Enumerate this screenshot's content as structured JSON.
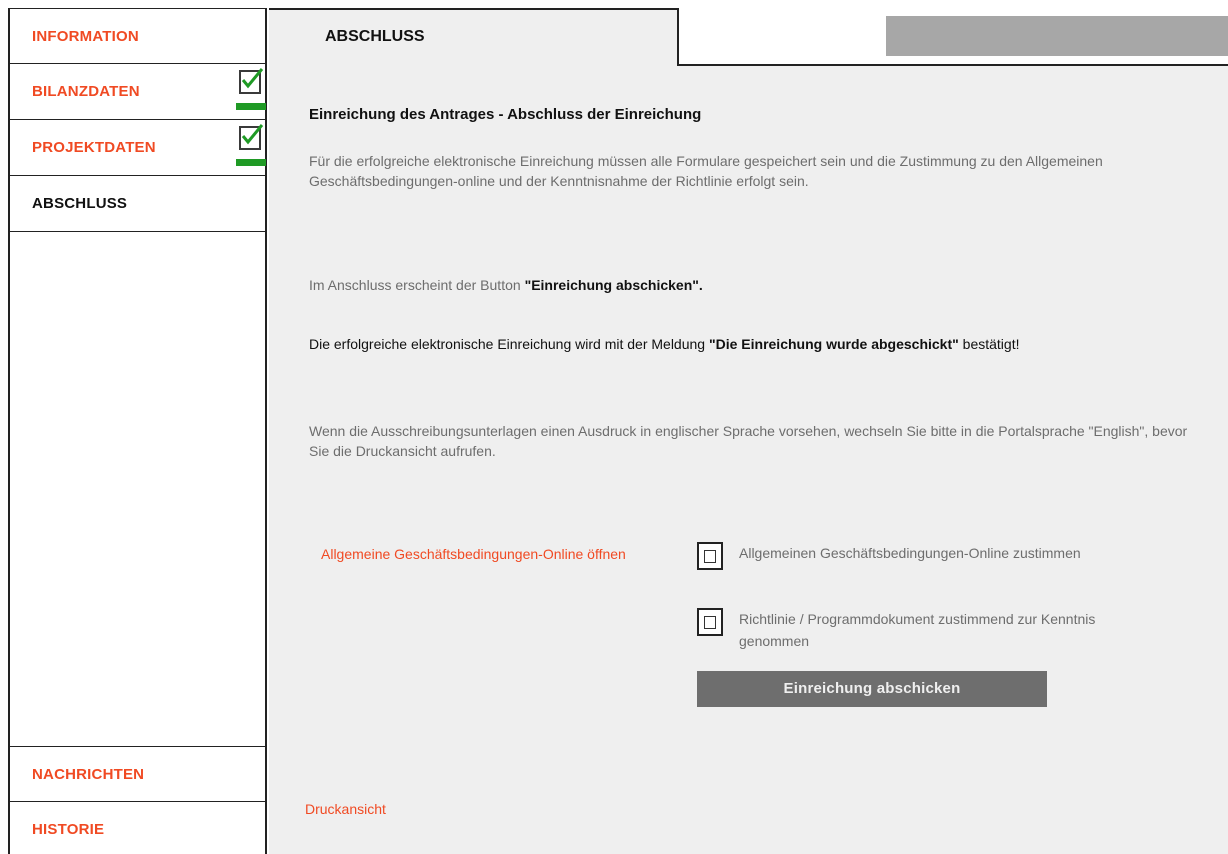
{
  "sidebar": {
    "items": [
      {
        "label": "INFORMATION",
        "checked": false
      },
      {
        "label": "BILANZDATEN",
        "checked": true
      },
      {
        "label": "PROJEKTDATEN",
        "checked": true
      },
      {
        "label": "ABSCHLUSS",
        "active": true
      }
    ],
    "bottom_items": [
      {
        "label": "NACHRICHTEN"
      },
      {
        "label": "HISTORIE"
      }
    ],
    "check_icon": "checkmark-icon",
    "colors": {
      "link": "#f04a23",
      "check": "#1f9a25"
    }
  },
  "tab": {
    "label": "ABSCHLUSS"
  },
  "content": {
    "heading": "Einreichung des Antrages - Abschluss der Einreichung",
    "para1": " Für die erfolgreiche elektronische Einreichung müssen alle Formulare gespeichert sein und die Zustimmung zu den Allgemeinen Geschäftsbedingungen-online und der Kenntnisnahme der Richtlinie erfolgt sein.",
    "para2_prefix": "Im Anschluss erscheint der Button ",
    "para2_bold": "\"Einreichung abschicken\".",
    "para3_prefix": "Die erfolgreiche elektronische Einreichung wird mit der Meldung ",
    "para3_bold": "\"Die Einreichung wurde abgeschickt\"",
    "para3_suffix": " bestätigt!",
    "para4": "Wenn die Ausschreibungsunterlagen einen Ausdruck in englischer Sprache vorsehen, wechseln Sie bitte in die Portalsprache \"English\", bevor Sie die Druckansicht aufrufen.",
    "agb_link": "Allgemeine Geschäftsbedingungen-Online öffnen",
    "checkbox1_label": "Allgemeinen Geschäftsbedingungen-Online zustimmen",
    "checkbox2_label": "Richtlinie / Programmdokument zustimmend zur Kenntnis genommen",
    "submit_label": "Einreichung abschicken",
    "print_link": "Druckansicht"
  }
}
